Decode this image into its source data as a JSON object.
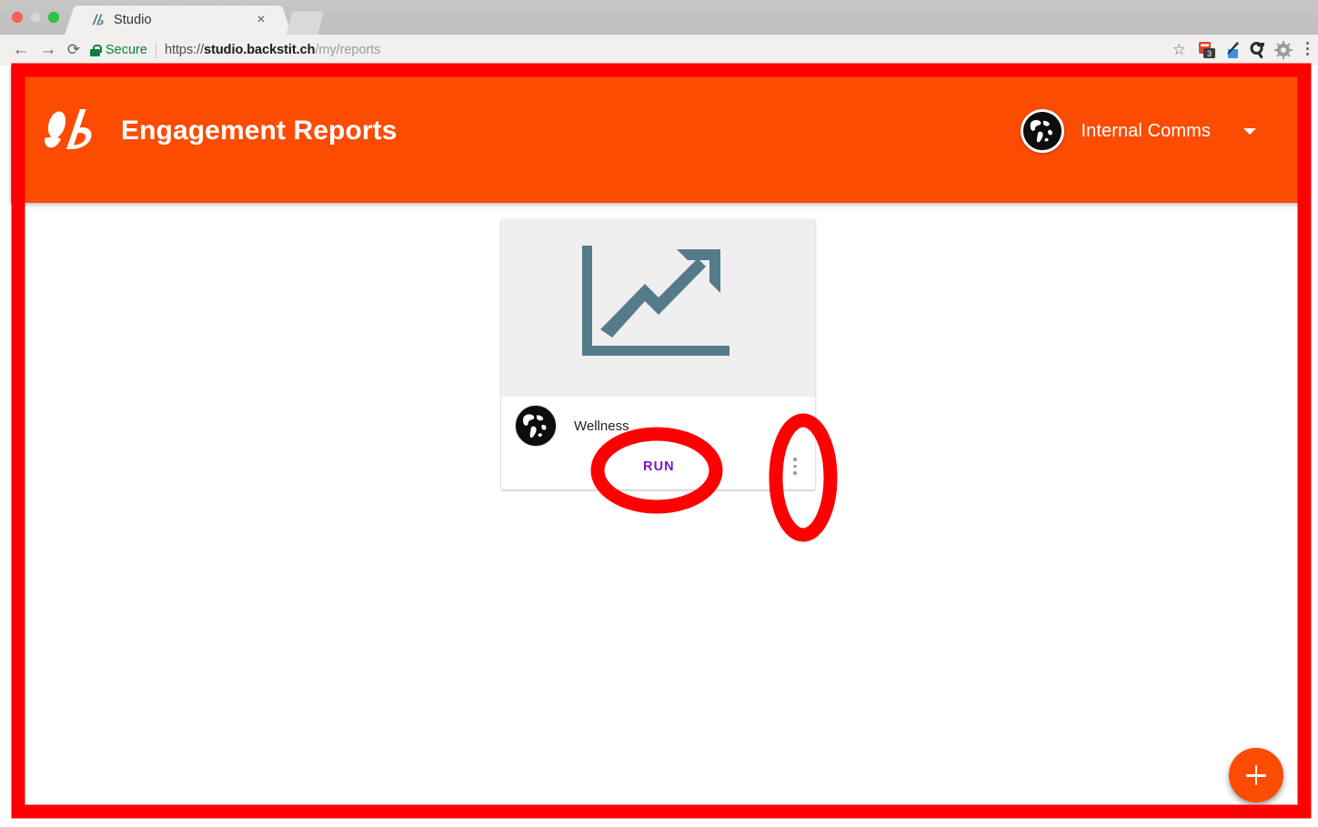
{
  "browser": {
    "window_controls": [
      "close",
      "minimize",
      "zoom"
    ],
    "tab": {
      "title": "Studio",
      "favicon": "backstitch-b-icon",
      "close_glyph": "×"
    },
    "new_tab_button": "new-tab",
    "nav": {
      "back_glyph": "←",
      "forward_glyph": "→",
      "reload_glyph": "⟳"
    },
    "omnibox": {
      "security_label": "Secure",
      "security_icon": "lock-icon",
      "url_scheme": "https://",
      "url_host": "studio.backstit.ch",
      "url_path": "/my/reports",
      "full_url": "https://studio.backstit.ch/my/reports",
      "bookmark_glyph": "☆"
    },
    "extensions": [
      {
        "name": "calendar-extension-icon",
        "badge": "3",
        "color": "#e8412c"
      },
      {
        "name": "eyedropper-extension-icon",
        "color": "#3f8ee8"
      },
      {
        "name": "magnifier-extension-icon",
        "color": "#2a2a2a"
      },
      {
        "name": "gear-extension-icon",
        "color": "#8b8b8b"
      }
    ],
    "chrome_menu": "chrome-menu-icon"
  },
  "app": {
    "header": {
      "brand_logo": "backstitch-brush-b-logo",
      "title": "Engagement Reports",
      "background_color": "#FC4C02",
      "org_switcher": {
        "avatar_icon": "globe-avatar-icon",
        "name": "Internal Comms",
        "caret_icon": "chevron-down-icon"
      }
    },
    "reports": [
      {
        "thumbnail_icon": "line-chart-up-arrow-icon",
        "thumbnail_color": "#557A8C",
        "thumbnail_background": "#EFEFEF",
        "owner_avatar_icon": "globe-avatar-icon",
        "name": "Wellness",
        "run_label": "RUN",
        "run_color": "#7B17C7",
        "overflow_menu_icon": "kebab-menu-icon"
      }
    ],
    "fab": {
      "icon": "plus-icon",
      "color": "#FC4C02"
    }
  },
  "annotations": {
    "highlight_color": "#FF0000",
    "border_label": "page-outline-highlight",
    "ellipses": [
      {
        "target": "run-button",
        "shape": "ellipse"
      },
      {
        "target": "report-overflow-menu",
        "shape": "ellipse"
      }
    ]
  }
}
